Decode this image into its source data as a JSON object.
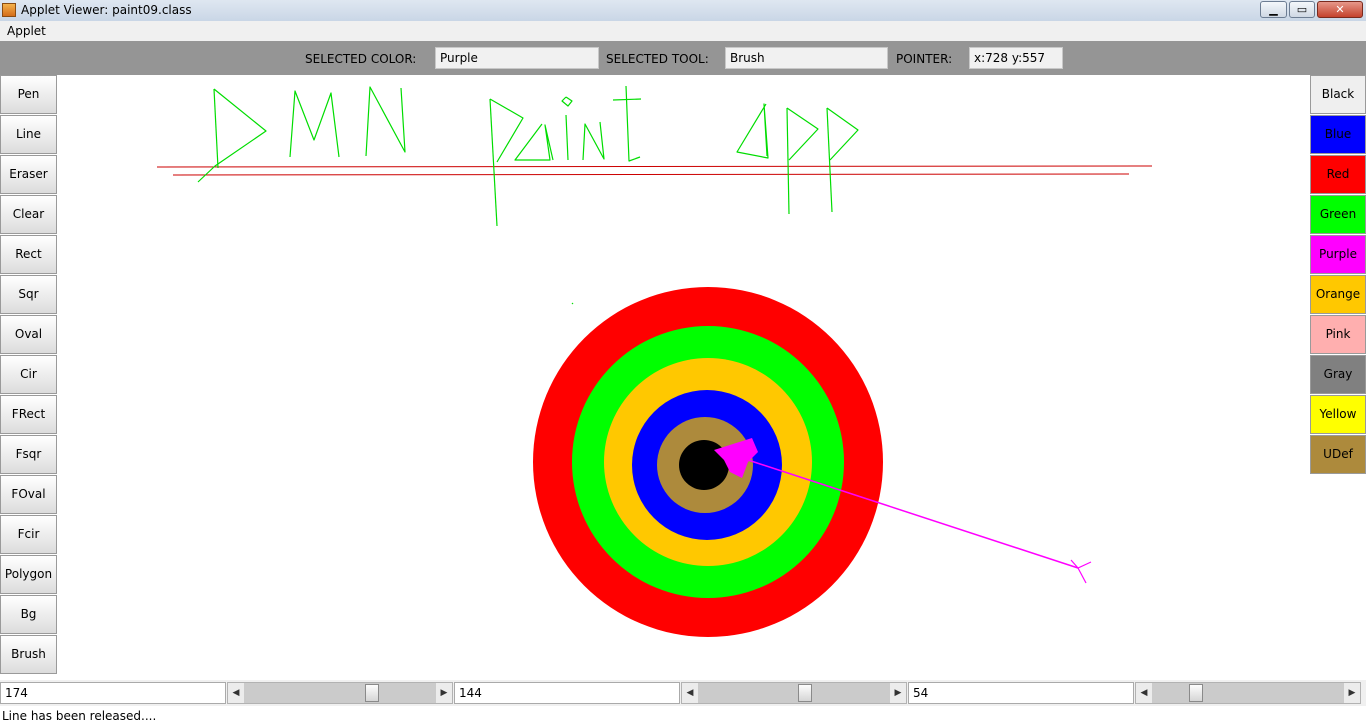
{
  "window": {
    "title": "Applet Viewer: paint09.class",
    "controls": {
      "minimize": "▁",
      "maximize": "▭",
      "close": "✕"
    }
  },
  "menu": {
    "applet": "Applet"
  },
  "toolbar": {
    "selected_color_label": "SELECTED COLOR:",
    "selected_color_value": "Purple",
    "selected_tool_label": "SELECTED TOOL:",
    "selected_tool_value": "Brush",
    "pointer_label": "POINTER:",
    "pointer_value": "x:728  y:557"
  },
  "tools": [
    "Pen",
    "Line",
    "Eraser",
    "Clear",
    "Rect",
    "Sqr",
    "Oval",
    "Cir",
    "FRect",
    "Fsqr",
    "FOval",
    "Fcir",
    "Polygon",
    "Bg",
    "Brush"
  ],
  "colors": [
    {
      "label": "Black",
      "bg": "#efefef",
      "fg": "#000000"
    },
    {
      "label": "Blue",
      "bg": "#0000ff",
      "fg": "#000000"
    },
    {
      "label": "Red",
      "bg": "#ff0000",
      "fg": "#000000"
    },
    {
      "label": "Green",
      "bg": "#00ff00",
      "fg": "#000000"
    },
    {
      "label": "Purple",
      "bg": "#ff00ff",
      "fg": "#000000"
    },
    {
      "label": "Orange",
      "bg": "#ffc800",
      "fg": "#000000"
    },
    {
      "label": "Pink",
      "bg": "#ffafaf",
      "fg": "#000000"
    },
    {
      "label": "Gray",
      "bg": "#808080",
      "fg": "#000000"
    },
    {
      "label": "Yellow",
      "bg": "#ffff00",
      "fg": "#000000"
    },
    {
      "label": "UDef",
      "bg": "#ad8a3c",
      "fg": "#000000"
    }
  ],
  "rgb_controls": [
    {
      "value": "174",
      "fraction": 0.68
    },
    {
      "value": "144",
      "fraction": 0.56
    },
    {
      "value": "54",
      "fraction": 0.21
    }
  ],
  "status": "Line has been released....",
  "canvas": {
    "target_ring_colors": [
      "#ff0000",
      "#00ff00",
      "#ffc800",
      "#0000ff",
      "#ad8a3c",
      "#000000"
    ],
    "sketch_color": "#00dd00",
    "line_color": "#cc0000",
    "arrow_color": "#ff00ff"
  }
}
